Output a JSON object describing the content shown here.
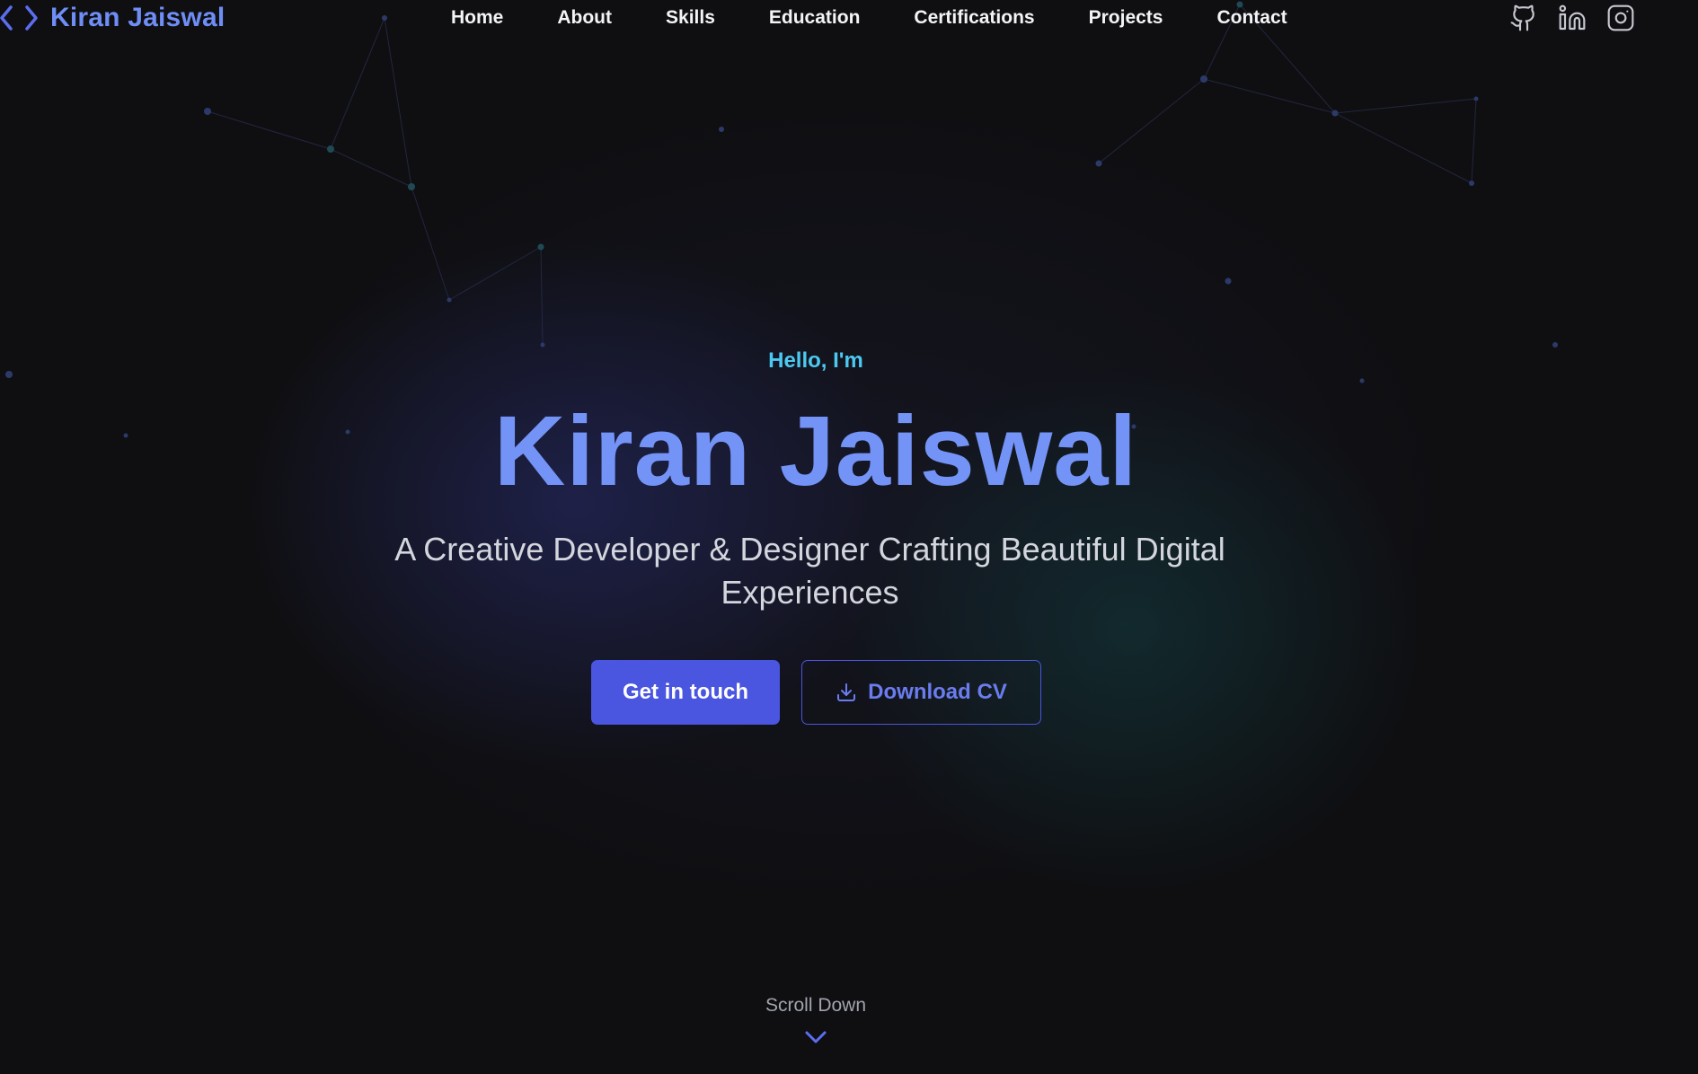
{
  "brand": {
    "name": "Kiran Jaiswal",
    "icon": "code-brackets-icon"
  },
  "nav": {
    "links": [
      {
        "label": "Home"
      },
      {
        "label": "About"
      },
      {
        "label": "Skills"
      },
      {
        "label": "Education"
      },
      {
        "label": "Certifications"
      },
      {
        "label": "Projects"
      },
      {
        "label": "Contact"
      }
    ]
  },
  "socials": [
    {
      "icon": "github-icon"
    },
    {
      "icon": "linkedin-icon"
    },
    {
      "icon": "instagram-icon"
    }
  ],
  "hero": {
    "greeting": "Hello, I'm",
    "name": "Kiran Jaiswal",
    "tagline": "A Creative Developer & Designer Crafting Beautiful Digital Experiences",
    "primary_button": "Get in touch",
    "secondary_button": "Download CV",
    "secondary_icon": "download-icon"
  },
  "scroll": {
    "label": "Scroll Down",
    "icon": "chevron-down-icon"
  },
  "colors": {
    "background": "#0f0f12",
    "accent": "#4a55e0",
    "brand_text": "#6f8ef5",
    "greeting": "#4cc9f0"
  }
}
